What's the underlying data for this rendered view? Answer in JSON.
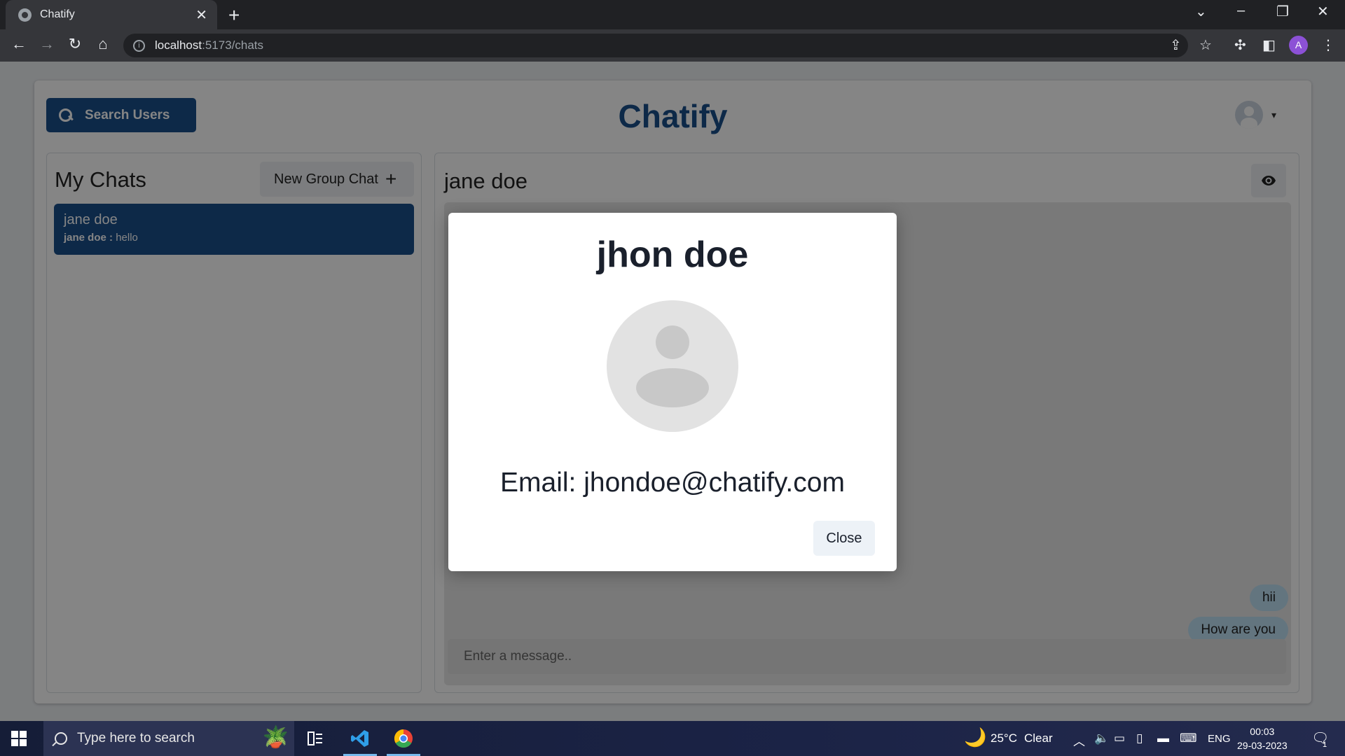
{
  "browser": {
    "tab_title": "Chatify",
    "tab_close": "✕",
    "new_tab": "+",
    "url_host": "localhost",
    "url_path": ":5173/chats"
  },
  "app": {
    "search_label": "Search Users",
    "brand": "Chatify",
    "my_chats_title": "My Chats",
    "new_group_label": "New Group Chat",
    "chats": [
      {
        "name": "jane doe",
        "last_sender": "jane doe :",
        "last_message": "hello"
      }
    ],
    "conversation_title": "jane doe",
    "messages": [
      {
        "text": "hii"
      },
      {
        "text": "How are you"
      }
    ],
    "message_placeholder": "Enter a message.."
  },
  "modal": {
    "title": "jhon doe",
    "email": "Email: jhondoe@chatify.com",
    "close_label": "Close"
  },
  "taskbar": {
    "search_placeholder": "Type here to search",
    "weather_temp": "25°C",
    "weather_desc": "Clear",
    "language": "ENG",
    "time": "00:03",
    "date": "29-03-2023",
    "notification_count": "1"
  },
  "colors": {
    "primary": "#1a4f8b",
    "bubble": "#bfe0f4",
    "profile": "#8c51d6"
  }
}
